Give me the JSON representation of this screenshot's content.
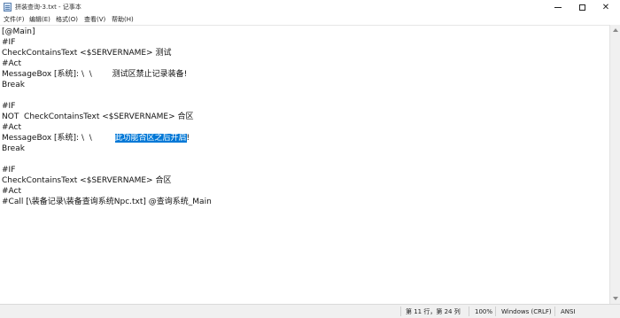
{
  "window": {
    "title": "拼装查询-3.txt - 记事本"
  },
  "menu": [
    "文件(F)",
    "编辑(E)",
    "格式(O)",
    "查看(V)",
    "帮助(H)"
  ],
  "editor": {
    "lines": [
      {
        "text": "[@Main]"
      },
      {
        "text": "#IF"
      },
      {
        "text": "CheckContainsText <$SERVERNAME> 测试"
      },
      {
        "text": "#Act"
      },
      {
        "text": "MessageBox [系统]: \\  \\        测试区禁止记录装备!"
      },
      {
        "text": "Break"
      },
      {
        "text": ""
      },
      {
        "text": "#IF"
      },
      {
        "text": "NOT  CheckContainsText <$SERVERNAME> 合区"
      },
      {
        "text": "#Act"
      },
      {
        "pre": "MessageBox [系统]: \\  \\         ",
        "selected": "此功能合区之后开启",
        "post": "!"
      },
      {
        "text": "Break"
      },
      {
        "text": ""
      },
      {
        "text": "#IF"
      },
      {
        "text": "CheckContainsText <$SERVERNAME> 合区"
      },
      {
        "text": "#Act"
      },
      {
        "text": "#Call [\\装备记录\\装备查询系统Npc.txt] @查询系统_Main"
      }
    ]
  },
  "status": {
    "position": "第 11 行，第 24 列",
    "zoom": "100%",
    "line_ending": "Windows (CRLF)",
    "encoding": "ANSI"
  }
}
